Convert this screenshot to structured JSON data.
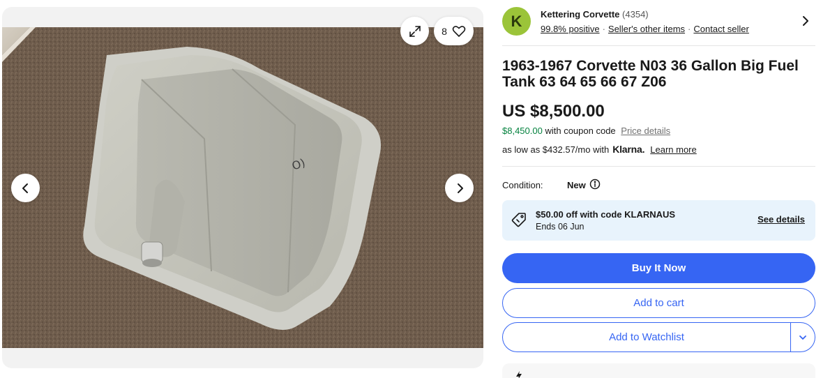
{
  "gallery": {
    "watch_count": "8",
    "icons": {
      "expand": "expand-icon",
      "heart": "heart-icon",
      "prev": "chevron-left-icon",
      "next": "chevron-right-icon"
    }
  },
  "seller": {
    "avatar_letter": "K",
    "name": "Kettering Corvette",
    "score": "(4354)",
    "feedback": "99.8% positive",
    "other_items": "Seller's other items",
    "contact": "Contact seller",
    "avatar_color": "#9bc439"
  },
  "listing": {
    "title": "1963-1967 Corvette N03 36 Gallon Big Fuel Tank 63 64 65 66 67 Z06",
    "price": "US $8,500.00",
    "coupon_price": "$8,450.00",
    "coupon_text": "with coupon code",
    "price_details": "Price details",
    "klarna_prefix": "as low as $432.57/mo with",
    "klarna_brand": "Klarna.",
    "learn_more": "Learn more"
  },
  "condition": {
    "label": "Condition:",
    "value": "New"
  },
  "promo": {
    "title": "$50.00 off with code KLARNAUS",
    "subtitle": "Ends 06 Jun",
    "link": "See details"
  },
  "actions": {
    "buy_now": "Buy It Now",
    "add_to_cart": "Add to cart",
    "add_to_watchlist": "Add to Watchlist"
  },
  "colors": {
    "primary": "#3665f3",
    "positive_green": "#05823f",
    "promo_bg": "#e8f3fc"
  }
}
